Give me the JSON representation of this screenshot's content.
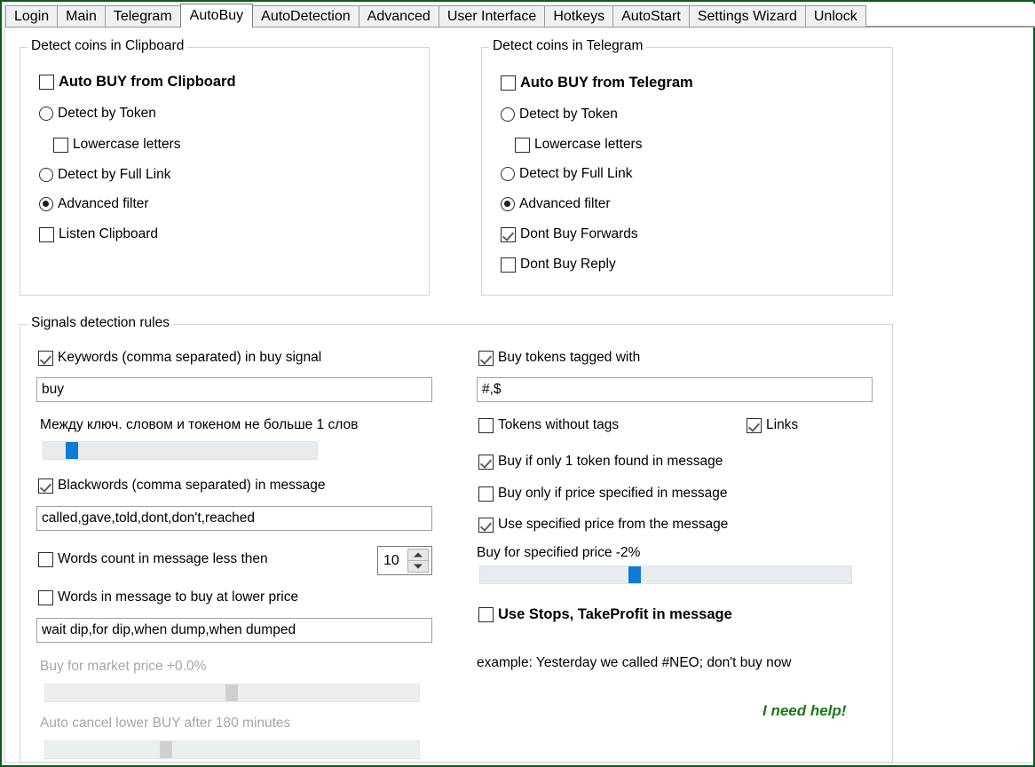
{
  "window": {
    "border_color": "#0a5a1e"
  },
  "tabs": [
    {
      "label": "Login",
      "active": false
    },
    {
      "label": "Main",
      "active": false
    },
    {
      "label": "Telegram",
      "active": false
    },
    {
      "label": "AutoBuy",
      "active": true
    },
    {
      "label": "AutoDetection",
      "active": false
    },
    {
      "label": "Advanced",
      "active": false
    },
    {
      "label": "User Interface",
      "active": false
    },
    {
      "label": "Hotkeys",
      "active": false
    },
    {
      "label": "AutoStart",
      "active": false
    },
    {
      "label": "Settings Wizard",
      "active": false
    },
    {
      "label": "Unlock",
      "active": false
    }
  ],
  "clipboard_group": {
    "title": "Detect coins in Clipboard",
    "auto_buy": {
      "label": "Auto BUY from Clipboard",
      "checked": false
    },
    "detect_by_token": {
      "label": "Detect by Token",
      "selected": false
    },
    "lowercase_letters": {
      "label": "Lowercase letters",
      "checked": false
    },
    "detect_by_full_link": {
      "label": "Detect by Full Link",
      "selected": false
    },
    "advanced_filter": {
      "label": "Advanced filter",
      "selected": true
    },
    "listen_clipboard": {
      "label": "Listen Clipboard",
      "checked": false
    }
  },
  "telegram_group": {
    "title": "Detect coins in Telegram",
    "auto_buy": {
      "label": "Auto BUY from Telegram",
      "checked": false
    },
    "detect_by_token": {
      "label": "Detect by Token",
      "selected": false
    },
    "lowercase_letters": {
      "label": "Lowercase letters",
      "checked": false
    },
    "detect_by_full_link": {
      "label": "Detect by Full Link",
      "selected": false
    },
    "advanced_filter": {
      "label": "Advanced filter",
      "selected": true
    },
    "dont_buy_forwards": {
      "label": "Dont Buy Forwards",
      "checked": true
    },
    "dont_buy_reply": {
      "label": "Dont Buy Reply",
      "checked": false
    }
  },
  "signals_group": {
    "title": "Signals detection rules",
    "keywords": {
      "label": "Keywords (comma separated) in buy signal",
      "checked": true,
      "value": "buy"
    },
    "distance_slider": {
      "label": "Между ключ. словом и токеном не больше 1 слов",
      "value": 1,
      "percent": 9,
      "enabled": true
    },
    "blackwords": {
      "label": "Blackwords (comma separated) in message",
      "checked": true,
      "value": "called,gave,told,dont,don't,reached"
    },
    "words_count": {
      "label": "Words count in message less then",
      "checked": false,
      "value": "10"
    },
    "lower_price_words": {
      "label": "Words in message to buy at lower price",
      "checked": false,
      "value": "wait dip,for dip,when dump,when dumped"
    },
    "market_price_slider": {
      "label": "Buy for market price +0.0%",
      "percent": 50,
      "enabled": false
    },
    "auto_cancel_slider": {
      "label": "Auto cancel lower BUY after 180 minutes",
      "percent": 32,
      "enabled": false
    },
    "buy_tokens_tagged": {
      "label": "Buy tokens tagged with",
      "checked": true,
      "value": "#,$"
    },
    "tokens_without_tags": {
      "label": "Tokens without tags",
      "checked": false
    },
    "links": {
      "label": "Links",
      "checked": true
    },
    "buy_if_one_token": {
      "label": "Buy if only 1 token found in message",
      "checked": true
    },
    "buy_only_if_price": {
      "label": "Buy only if price specified in message",
      "checked": false
    },
    "use_specified_price": {
      "label": "Use specified price from the message",
      "checked": true
    },
    "specified_price_slider": {
      "label": "Buy for specified price -2%",
      "percent": 40,
      "enabled": true
    },
    "use_stops": {
      "label": "Use Stops, TakeProfit in message",
      "checked": false
    },
    "example_text": "example: Yesterday we called #NEO; don't buy now",
    "help_link": {
      "label": "I need help!",
      "color": "#1a7a1a"
    }
  }
}
